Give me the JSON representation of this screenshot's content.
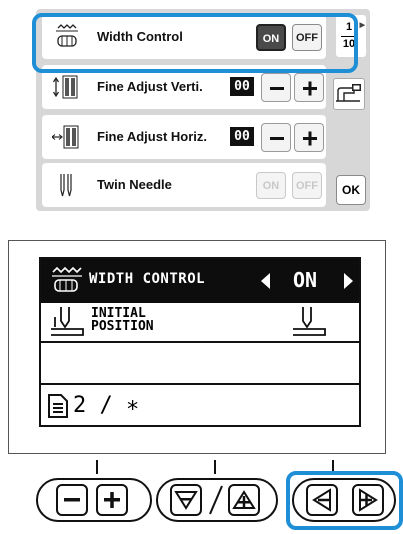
{
  "screen": {
    "rows": [
      {
        "label": "Width Control",
        "on": "ON",
        "off": "OFF",
        "state": "on"
      },
      {
        "label": "Fine Adjust Verti.",
        "value": "00"
      },
      {
        "label": "Fine Adjust Horiz.",
        "value": "00"
      },
      {
        "label": "Twin Needle",
        "on": "ON",
        "off": "OFF",
        "state": "disabled"
      }
    ],
    "page": {
      "current": "1",
      "total": "10"
    },
    "ok_label": "OK"
  },
  "lcd": {
    "row1_label": "WIDTH CONTROL",
    "row1_value": "ON",
    "row2_label": "INITIAL\nPOSITION",
    "row4_label": "2 / ∗"
  },
  "colors": {
    "highlight": "#1e8fd6",
    "lcd_bg": "#0d0d0d"
  },
  "icons": [
    "width-control-icon",
    "vertical-adjust-icon",
    "horizontal-adjust-icon",
    "twin-needle-icon",
    "machine-icon",
    "page-icon",
    "needle-position-icon",
    "minus-icon",
    "plus-icon",
    "down-icon",
    "up-icon",
    "left-icon",
    "right-icon"
  ]
}
